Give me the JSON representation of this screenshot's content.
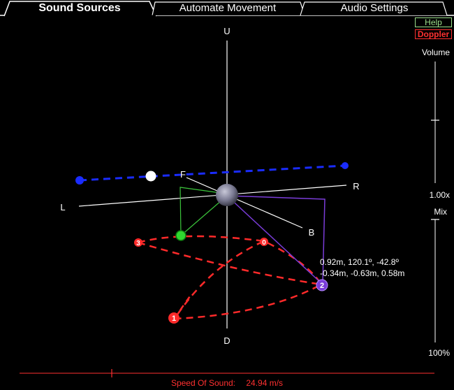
{
  "tabs": [
    {
      "label": "Sound Sources",
      "active": true
    },
    {
      "label": "Automate Movement",
      "active": false
    },
    {
      "label": "Audio Settings",
      "active": false
    }
  ],
  "buttons": {
    "help": "Help",
    "doppler": "Doppler"
  },
  "sliders": {
    "volume": {
      "label": "Volume",
      "value_text": "1.00x"
    },
    "mix": {
      "label": "Mix",
      "value_text": "100%"
    }
  },
  "axes": {
    "up": "U",
    "down": "D",
    "left": "L",
    "right": "R",
    "front": "F",
    "back": "B"
  },
  "sources": [
    {
      "label": "0",
      "color": "#ff2a2a"
    },
    {
      "label": "1",
      "color": "#ff2a2a"
    },
    {
      "label": "2",
      "color": "#7a3cd8"
    },
    {
      "label": "3",
      "color": "#ff2a2a"
    }
  ],
  "readout": {
    "line1": "0.92m, 120.1º, -42.8º",
    "line2": "-0.34m, -0.63m, 0.58m"
  },
  "speed_of_sound": {
    "label": "Speed Of Sound:",
    "value": "24.94 m/s"
  },
  "colors": {
    "accent_red": "#ff3030",
    "help_green": "#9be08a",
    "path_blue": "#1a2cff",
    "green_source": "#2fd82f",
    "purple_source": "#7a3cd8"
  }
}
